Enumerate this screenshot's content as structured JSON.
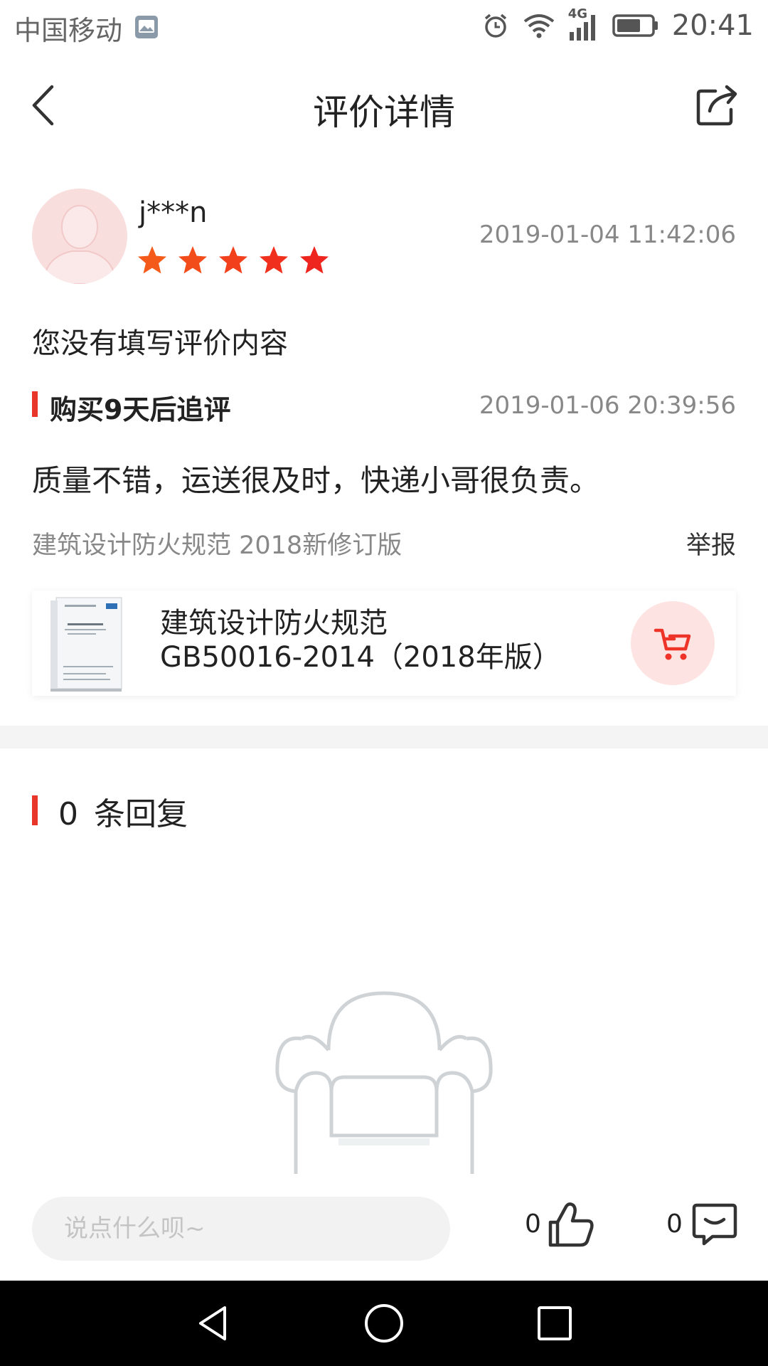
{
  "status_bar": {
    "carrier": "中国移动",
    "network": "4G",
    "time": "20:41"
  },
  "nav": {
    "title": "评价详情"
  },
  "review": {
    "username": "j***n",
    "rating": 5,
    "max_rating": 5,
    "time": "2019-01-04 11:42:06",
    "content": "您没有填写评价内容"
  },
  "followup": {
    "title": "购买9天后追评",
    "time": "2019-01-06 20:39:56",
    "content": "质量不错，运送很及时，快递小哥很负责。"
  },
  "product": {
    "spec": "建筑设计防火规范 2018新修订版",
    "report_label": "举报",
    "name_line1": "建筑设计防火规范",
    "name_line2": "GB50016-2014（2018年版）"
  },
  "replies": {
    "count": "0",
    "label": "条回复"
  },
  "bottom_bar": {
    "comment_placeholder": "说点什么呗~",
    "like_count": "0",
    "message_count": "0"
  },
  "colors": {
    "accent": "#e8362b",
    "star": "#f03c1e"
  },
  "icons": [
    "image-icon",
    "alarm-icon",
    "wifi-icon",
    "signal-icon",
    "battery-icon",
    "back-arrow-icon",
    "share-icon",
    "avatar-icon",
    "star-icon",
    "cart-icon",
    "empty-sofa-icon",
    "thumbs-up-icon",
    "message-icon",
    "nav-back-icon",
    "nav-home-icon",
    "nav-recent-icon"
  ]
}
